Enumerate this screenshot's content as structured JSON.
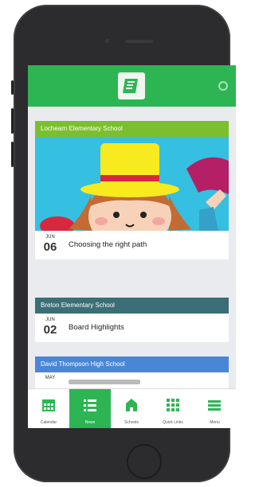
{
  "cards": [
    {
      "school": "Lochearn Elementary School",
      "header_color": "#7cbf2e",
      "month": "JUN",
      "day": "06",
      "title": "Choosing the right path"
    },
    {
      "school": "Breton Elementary School",
      "header_color": "#3b6e76",
      "month": "JUN",
      "day": "02",
      "title": "Board Highlights"
    },
    {
      "school": "David Thompson High School",
      "header_color": "#4a86d6",
      "month": "MAY",
      "day": "",
      "title": ""
    }
  ],
  "tabs": [
    {
      "label": "Calendar",
      "icon": "calendar-icon"
    },
    {
      "label": "News",
      "icon": "list-icon",
      "active": true
    },
    {
      "label": "Schools",
      "icon": "school-icon"
    },
    {
      "label": "Quick Links",
      "icon": "grid-icon"
    },
    {
      "label": "Menu",
      "icon": "menu-icon"
    }
  ],
  "colors": {
    "brand_green": "#2db553",
    "screen_bg": "#e9ebee"
  }
}
